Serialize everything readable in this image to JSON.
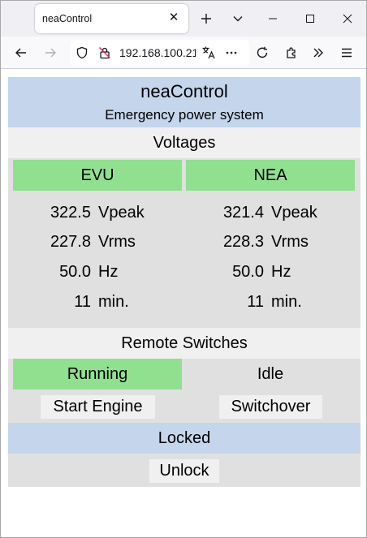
{
  "browser": {
    "tab_title": "neaControl",
    "url": "192.168.100.21",
    "icons": [
      "close-icon",
      "new-tab-icon",
      "list-tabs-icon",
      "minimize-icon",
      "maximize-icon",
      "window-close-icon",
      "back-icon",
      "forward-icon",
      "shield-icon",
      "insecure-lock-icon",
      "translate-icon",
      "page-actions-icon",
      "reload-icon",
      "extensions-icon",
      "overflow-icon",
      "menu-icon"
    ]
  },
  "header": {
    "title": "neaControl",
    "subtitle": "Emergency power system"
  },
  "voltages": {
    "heading": "Voltages",
    "columns": [
      {
        "name": "EVU",
        "rows": [
          {
            "value": "322.5",
            "unit": "Vpeak"
          },
          {
            "value": "227.8",
            "unit": "Vrms"
          },
          {
            "value": "50.0",
            "unit": "Hz"
          },
          {
            "value": "11",
            "unit": "min."
          }
        ]
      },
      {
        "name": "NEA",
        "rows": [
          {
            "value": "321.4",
            "unit": "Vpeak"
          },
          {
            "value": "228.3",
            "unit": "Vrms"
          },
          {
            "value": "50.0",
            "unit": "Hz"
          },
          {
            "value": "11",
            "unit": "min."
          }
        ]
      }
    ]
  },
  "remote": {
    "heading": "Remote Switches",
    "engine_state": "Running",
    "switch_state": "Idle",
    "start_engine_label": "Start Engine",
    "switchover_label": "Switchover"
  },
  "lock": {
    "status": "Locked",
    "unlock_label": "Unlock"
  },
  "colors": {
    "header_bg": "#c4d5ec",
    "active_green": "#90e090",
    "panel_bg": "#e0e0e0",
    "light_bg": "#f0f0f0"
  }
}
